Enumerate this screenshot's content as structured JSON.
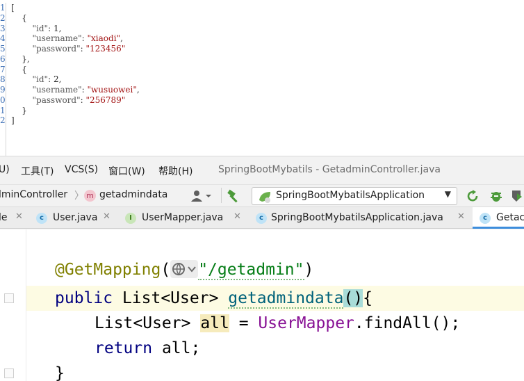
{
  "json_viewer": {
    "gutter_numbers": [
      "1",
      "2",
      "3",
      "4",
      "5",
      "6",
      "7",
      "8",
      "9",
      "0",
      "1",
      "2"
    ],
    "lines": [
      {
        "indent": "",
        "text": "["
      },
      {
        "indent": "    ",
        "text": "{"
      },
      {
        "indent": "        ",
        "key": "\"id\"",
        "sep": ": ",
        "num": "1",
        "tail": ","
      },
      {
        "indent": "        ",
        "key": "\"username\"",
        "sep": ": ",
        "str": "\"xiaodi\"",
        "tail": ","
      },
      {
        "indent": "        ",
        "key": "\"password\"",
        "sep": ": ",
        "str": "\"123456\"",
        "tail": ""
      },
      {
        "indent": "    ",
        "text": "},"
      },
      {
        "indent": "    ",
        "text": "{"
      },
      {
        "indent": "        ",
        "key": "\"id\"",
        "sep": ": ",
        "num": "2",
        "tail": ","
      },
      {
        "indent": "        ",
        "key": "\"username\"",
        "sep": ": ",
        "str": "\"wusuowei\"",
        "tail": ","
      },
      {
        "indent": "        ",
        "key": "\"password\"",
        "sep": ": ",
        "str": "\"256789\"",
        "tail": ""
      },
      {
        "indent": "    ",
        "text": "}"
      },
      {
        "indent": "",
        "text": "]"
      }
    ]
  },
  "menubar": {
    "items": [
      "U)",
      "工具(T)",
      "VCS(S)",
      "窗口(W)",
      "帮助(H)"
    ],
    "window_title": "SpringBootMybatils - GetadminController.java"
  },
  "navbar": {
    "crumb_controller": "lminController",
    "crumb_method": "getadmindata",
    "method_badge": "m",
    "run_config": "SpringBootMybatilsApplication"
  },
  "tabs": [
    {
      "label": "le",
      "icon": ""
    },
    {
      "label": "User.java",
      "icon": "c"
    },
    {
      "label": "UserMapper.java",
      "icon": "I"
    },
    {
      "label": "SpringBootMybatilsApplication.java",
      "icon": "c"
    },
    {
      "label": "Getac",
      "icon": "c"
    }
  ],
  "code": {
    "line1": {
      "annotation": "@GetMapping",
      "open": "(",
      "path": "\"/getadmin\"",
      "close": ")"
    },
    "line2": {
      "kw": "public",
      "type": " List<User> ",
      "method": "getadmindata",
      "caret_parens": "()",
      "brace": "{"
    },
    "line3": {
      "type": "List<User> ",
      "var": "all",
      "eq": " = ",
      "cls": "UserMapper",
      "call": ".findAll();"
    },
    "line4": {
      "kw": "return",
      "rest": " all;"
    },
    "line5": {
      "brace": "}"
    }
  },
  "colors": {
    "keyword": "#000080",
    "annotation": "#808000",
    "string": "#067d17",
    "method": "#00627a",
    "static_class": "#871094",
    "active_tab_accent": "#3d8ddc"
  }
}
